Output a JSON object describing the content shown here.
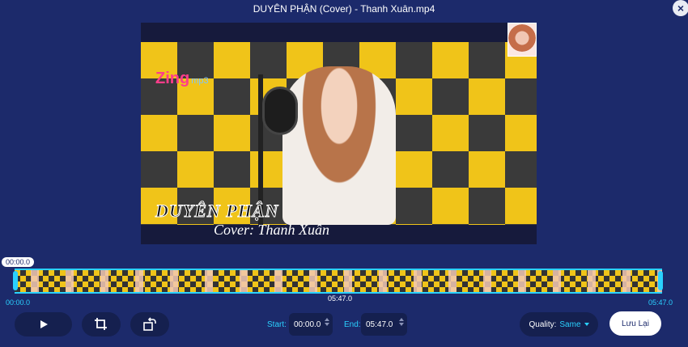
{
  "window": {
    "title": "DUYÊN PHẬN (Cover) - Thanh Xuân.mp4",
    "close_icon": "×"
  },
  "video": {
    "logo_main": "Zing",
    "logo_sub": "mp3",
    "song_title": "DUYÊN PHẬN",
    "cover_text": "Cover: Thanh Xuân"
  },
  "timeline": {
    "current_time": "00:00.0",
    "start_time": "00:00.0",
    "mid_time": "05:47.0",
    "end_time": "05:47.0"
  },
  "controls": {
    "start_label": "Start:",
    "start_value": "00:00.0",
    "end_label": "End:",
    "end_value": "05:47.0",
    "quality_label": "Quality:",
    "quality_value": "Same",
    "save_label": "Lưu Lại"
  }
}
